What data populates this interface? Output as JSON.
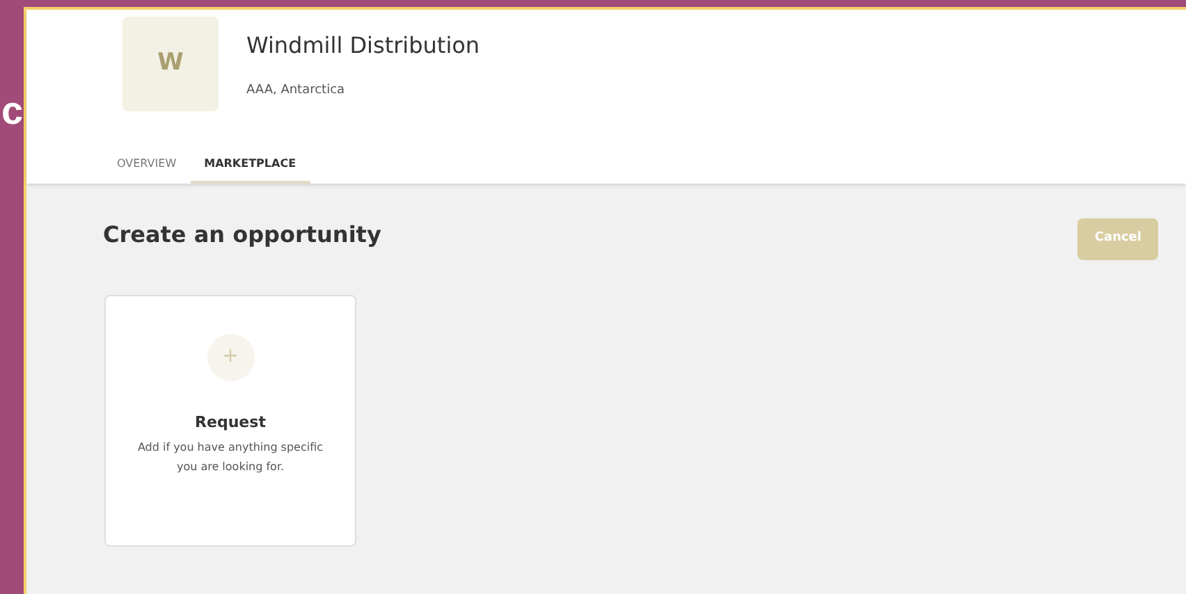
{
  "side_strip": {
    "letter": "c"
  },
  "company": {
    "initial": "W",
    "name": "Windmill Distribution",
    "location": "AAA, Antarctica"
  },
  "tabs": [
    {
      "label": "OVERVIEW",
      "selected": false
    },
    {
      "label": "MARKETPLACE",
      "selected": true
    }
  ],
  "page": {
    "title": "Create an opportunity",
    "cancel_button": "Cancel"
  },
  "cards": [
    {
      "icon": "+",
      "title": "Request",
      "description": "Add if you have anything specific you are looking for."
    }
  ]
}
